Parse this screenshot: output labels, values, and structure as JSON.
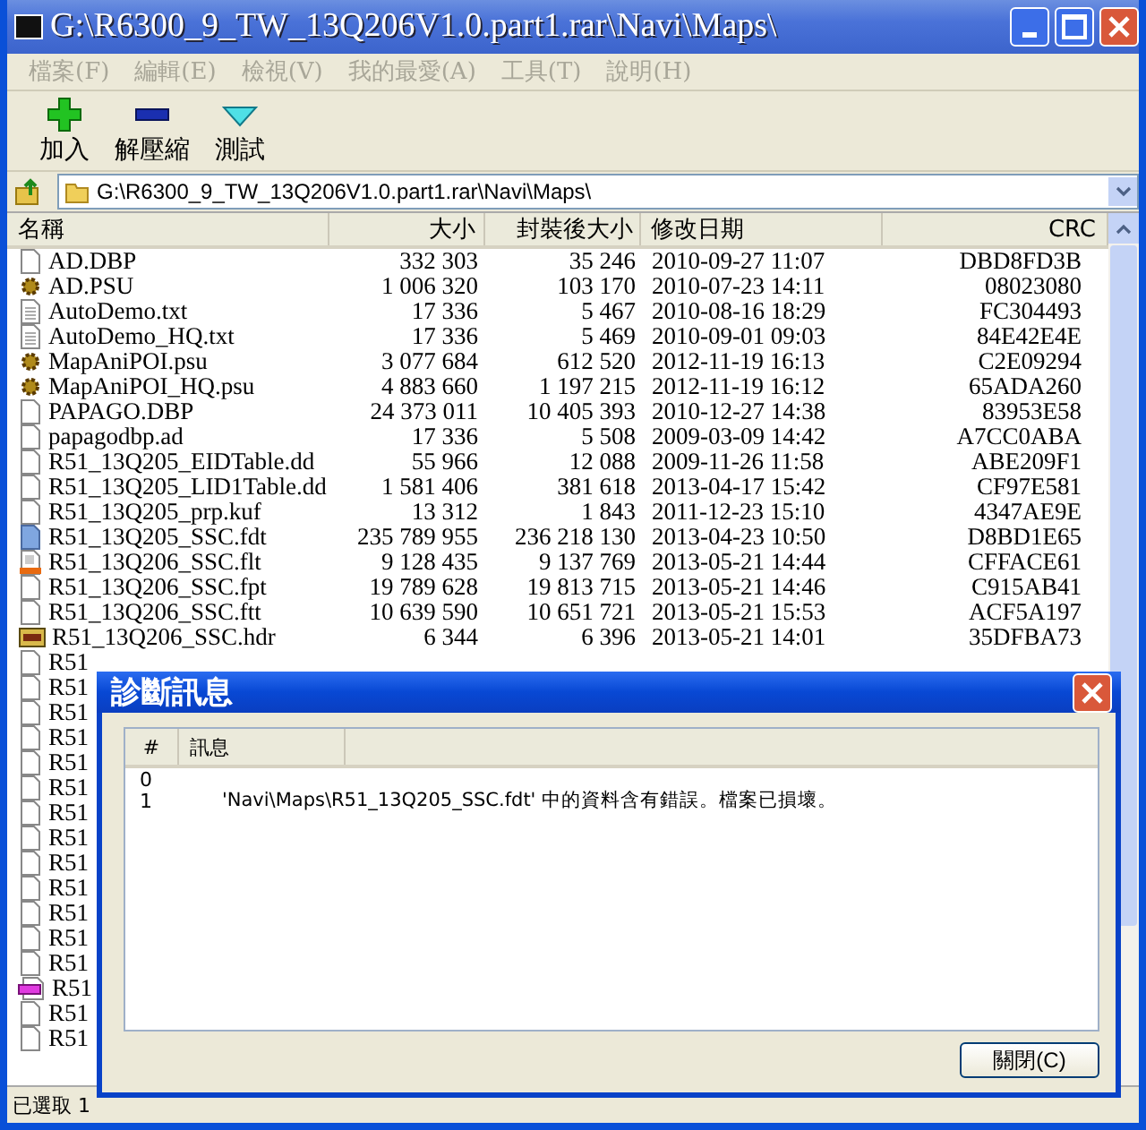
{
  "window": {
    "title": "G:\\R6300_9_TW_13Q206V1.0.part1.rar\\Navi\\Maps\\"
  },
  "menu": [
    {
      "label": "檔案(F)",
      "disabled": true
    },
    {
      "label": "編輯(E)",
      "disabled": true
    },
    {
      "label": "檢視(V)",
      "disabled": true
    },
    {
      "label": "我的最愛(A)",
      "disabled": true
    },
    {
      "label": "工具(T)",
      "disabled": true
    },
    {
      "label": "說明(H)",
      "disabled": true
    }
  ],
  "toolbar": [
    {
      "label": "加入",
      "kind": "add"
    },
    {
      "label": "解壓縮",
      "kind": "extract"
    },
    {
      "label": "測試",
      "kind": "test"
    }
  ],
  "address": "G:\\R6300_9_TW_13Q206V1.0.part1.rar\\Navi\\Maps\\",
  "table": {
    "columns": [
      "名稱",
      "大小",
      "封裝後大小",
      "修改日期",
      "CRC"
    ],
    "rows": [
      {
        "kind": "blank",
        "cells": [
          "AD.DBP",
          "332 303",
          "35 246",
          "2010-09-27 11:07",
          "DBD8FD3B"
        ]
      },
      {
        "kind": "gear",
        "cells": [
          "AD.PSU",
          "1 006 320",
          "103 170",
          "2010-07-23 14:11",
          "08023080"
        ]
      },
      {
        "kind": "text",
        "cells": [
          "AutoDemo.txt",
          "17 336",
          "5 467",
          "2010-08-16 18:29",
          "FC304493"
        ]
      },
      {
        "kind": "text",
        "cells": [
          "AutoDemo_HQ.txt",
          "17 336",
          "5 469",
          "2010-09-01 09:03",
          "84E42E4E"
        ]
      },
      {
        "kind": "gear",
        "cells": [
          "MapAniPOI.psu",
          "3 077 684",
          "612 520",
          "2012-11-19 16:13",
          "C2E09294"
        ]
      },
      {
        "kind": "gear",
        "cells": [
          "MapAniPOI_HQ.psu",
          "4 883 660",
          "1 197 215",
          "2012-11-19 16:12",
          "65ADA260"
        ]
      },
      {
        "kind": "blank",
        "cells": [
          "PAPAGO.DBP",
          "24 373 011",
          "10 405 393",
          "2010-12-27 14:38",
          "83953E58"
        ]
      },
      {
        "kind": "blank",
        "cells": [
          "papagodbp.ad",
          "17 336",
          "5 508",
          "2009-03-09 14:42",
          "A7CC0ABA"
        ]
      },
      {
        "kind": "blank",
        "cells": [
          "R51_13Q205_EIDTable.dd",
          "55 966",
          "12 088",
          "2009-11-26 11:58",
          "ABE209F1"
        ]
      },
      {
        "kind": "blank",
        "cells": [
          "R51_13Q205_LID1Table.dd",
          "1 581 406",
          "381 618",
          "2013-04-17 15:42",
          "CF97E581"
        ]
      },
      {
        "kind": "blank",
        "cells": [
          "R51_13Q205_prp.kuf",
          "13 312",
          "1 843",
          "2011-12-23 15:10",
          "4347AE9E"
        ]
      },
      {
        "kind": "blue",
        "cells": [
          "R51_13Q205_SSC.fdt",
          "235 789 955",
          "236 218 130",
          "2013-04-23 10:50",
          "D8BD1E65"
        ]
      },
      {
        "kind": "orange",
        "cells": [
          "R51_13Q206_SSC.flt",
          "9 128 435",
          "9 137 769",
          "2013-05-21 14:44",
          "CFFACE61"
        ]
      },
      {
        "kind": "blank",
        "cells": [
          "R51_13Q206_SSC.fpt",
          "19 789 628",
          "19 813 715",
          "2013-05-21 14:46",
          "C915AB41"
        ]
      },
      {
        "kind": "blank",
        "cells": [
          "R51_13Q206_SSC.ftt",
          "10 639 590",
          "10 651 721",
          "2013-05-21 15:53",
          "ACF5A197"
        ]
      },
      {
        "kind": "archive",
        "cells": [
          "R51_13Q206_SSC.hdr",
          "6 344",
          "6 396",
          "2013-05-21 14:01",
          "35DFBA73"
        ]
      },
      {
        "kind": "blank",
        "cells": [
          "R51"
        ]
      },
      {
        "kind": "blank",
        "cells": [
          "R51"
        ]
      },
      {
        "kind": "blank",
        "cells": [
          "R51"
        ]
      },
      {
        "kind": "blank",
        "cells": [
          "R51"
        ]
      },
      {
        "kind": "blank",
        "cells": [
          "R51"
        ]
      },
      {
        "kind": "blank",
        "cells": [
          "R51"
        ]
      },
      {
        "kind": "blank",
        "cells": [
          "R51"
        ]
      },
      {
        "kind": "blank",
        "cells": [
          "R51"
        ]
      },
      {
        "kind": "blank",
        "cells": [
          "R51"
        ]
      },
      {
        "kind": "blank",
        "cells": [
          "R51"
        ]
      },
      {
        "kind": "blank",
        "cells": [
          "R51"
        ]
      },
      {
        "kind": "blank",
        "cells": [
          "R51"
        ]
      },
      {
        "kind": "blank",
        "cells": [
          "R51"
        ]
      },
      {
        "kind": "pink",
        "cells": [
          "R51"
        ]
      },
      {
        "kind": "blank",
        "cells": [
          "R51"
        ]
      },
      {
        "kind": "blank",
        "cells": [
          "R51"
        ]
      }
    ]
  },
  "status_bar": "已選取 1",
  "dialog": {
    "title": "診斷訊息",
    "columns": [
      "#",
      "訊息"
    ],
    "rows": [
      {
        "number": "0"
      },
      {
        "number": "1",
        "message": "'Navi\\Maps\\R51_13Q205_SSC.fdt' 中的資料含有錯誤。檔案已損壞。"
      }
    ],
    "button": "關閉(C)"
  }
}
